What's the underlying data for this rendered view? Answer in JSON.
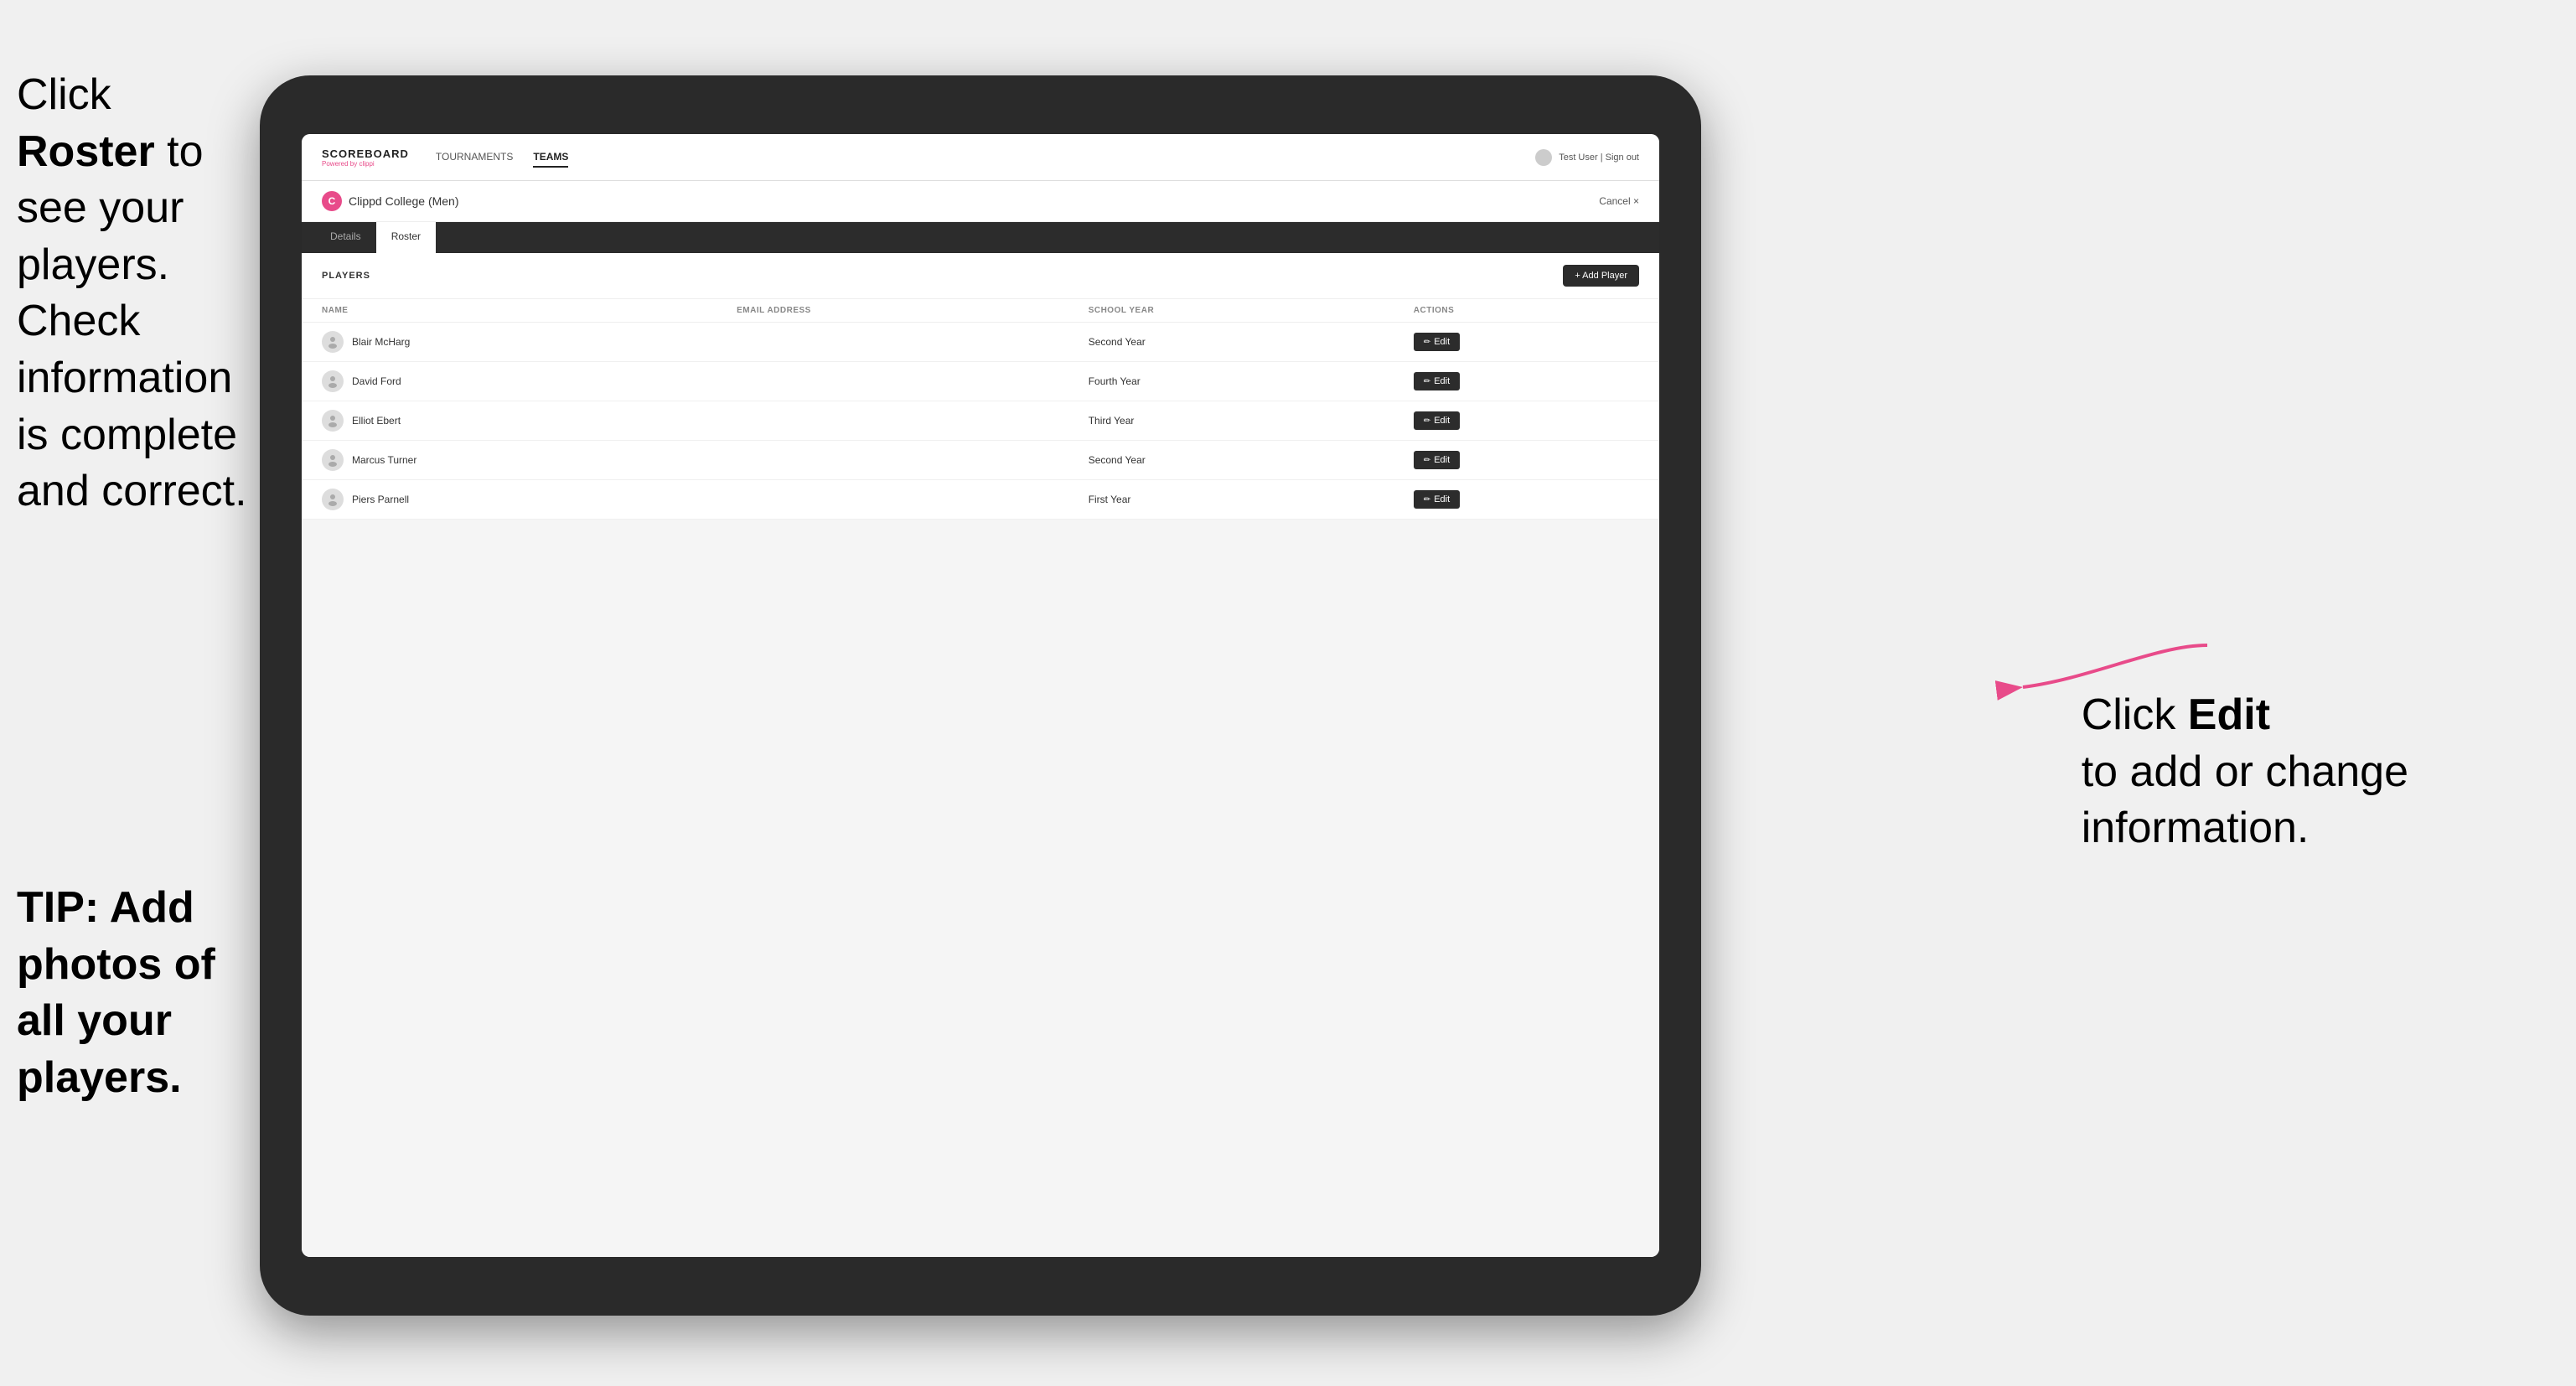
{
  "annotations": {
    "left_text_line1": "Click ",
    "left_text_bold": "Roster",
    "left_text_line2": " to see your players. Check information is complete and correct.",
    "tip_text": "TIP: Add photos of all your players.",
    "right_text_line1": "Click ",
    "right_text_bold": "Edit",
    "right_text_line2": " to add or change information."
  },
  "navbar": {
    "brand": "SCOREBOARD",
    "brand_sub": "Powered by clippi",
    "nav_items": [
      "TOURNAMENTS",
      "TEAMS"
    ],
    "active_nav": "TEAMS",
    "user_text": "Test User | Sign out"
  },
  "team": {
    "icon_letter": "C",
    "name": "Clippd College (Men)",
    "cancel_label": "Cancel ×"
  },
  "tabs": [
    {
      "label": "Details",
      "active": false
    },
    {
      "label": "Roster",
      "active": true
    }
  ],
  "players_section": {
    "title": "PLAYERS",
    "add_button_label": "+ Add Player"
  },
  "table": {
    "columns": [
      "NAME",
      "EMAIL ADDRESS",
      "SCHOOL YEAR",
      "ACTIONS"
    ],
    "rows": [
      {
        "name": "Blair McHarg",
        "email": "",
        "year": "Second Year"
      },
      {
        "name": "David Ford",
        "email": "",
        "year": "Fourth Year"
      },
      {
        "name": "Elliot Ebert",
        "email": "",
        "year": "Third Year"
      },
      {
        "name": "Marcus Turner",
        "email": "",
        "year": "Second Year"
      },
      {
        "name": "Piers Parnell",
        "email": "",
        "year": "First Year"
      }
    ],
    "edit_label": "Edit"
  }
}
